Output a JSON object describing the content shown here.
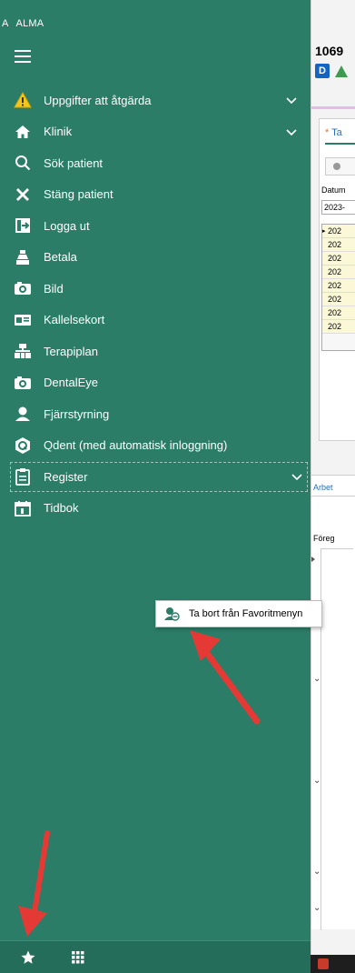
{
  "app": {
    "name": "ALMA"
  },
  "menu": {
    "items": [
      {
        "label": "Uppgifter att åtgärda",
        "icon": "warning-icon",
        "expandable": true
      },
      {
        "label": "Klinik",
        "icon": "home-icon",
        "expandable": true
      },
      {
        "label": "Sök patient",
        "icon": "search-icon",
        "expandable": false
      },
      {
        "label": "Stäng patient",
        "icon": "close-icon",
        "expandable": false
      },
      {
        "label": "Logga ut",
        "icon": "logout-icon",
        "expandable": false
      },
      {
        "label": "Betala",
        "icon": "payment-icon",
        "expandable": false
      },
      {
        "label": "Bild",
        "icon": "camera-icon",
        "expandable": false
      },
      {
        "label": "Kallelsekort",
        "icon": "card-icon",
        "expandable": false
      },
      {
        "label": "Terapiplan",
        "icon": "hierarchy-icon",
        "expandable": false
      },
      {
        "label": "DentalEye",
        "icon": "camera-icon",
        "expandable": false
      },
      {
        "label": "Fjärrstyrning",
        "icon": "person-icon",
        "expandable": false
      },
      {
        "label": "Qdent (med automatisk inloggning)",
        "icon": "qdent-icon",
        "expandable": false
      },
      {
        "label": "Register",
        "icon": "clipboard-icon",
        "expandable": true
      },
      {
        "label": "Tidbok",
        "icon": "calendar-icon",
        "expandable": false
      }
    ]
  },
  "context_menu": {
    "label": "Ta bort från Favoritmenyn",
    "icon": "remove-favorite-icon"
  },
  "bottom_bar": {
    "favorites_icon": "star-icon",
    "apps_icon": "grid-icon"
  },
  "main": {
    "patient_id": "1069",
    "badge": "D",
    "tab_label": "Ta",
    "date_label": "Datum",
    "date_value": "2023-",
    "rows": [
      "202",
      "202",
      "202",
      "202",
      "202",
      "202",
      "202",
      "202"
    ],
    "section_label": "Arbet",
    "foreg_label": "Föreg"
  },
  "colors": {
    "sidebar": "#2b7d68",
    "accent_warning": "#f5c518",
    "annotation_arrow": "#e53935"
  }
}
